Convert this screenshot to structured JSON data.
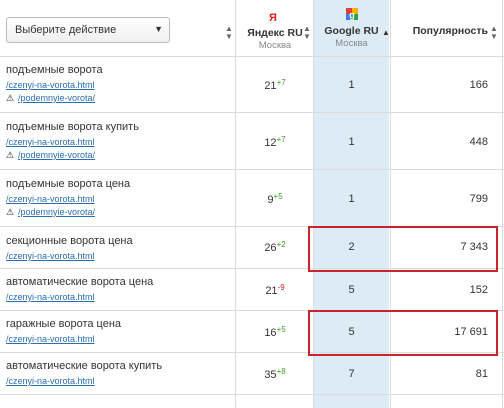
{
  "header": {
    "action_select_value": "Выберите действие",
    "yandex_title": "Яндекс RU",
    "yandex_region": "Москва",
    "google_title": "Google RU",
    "google_region": "Москва",
    "popularity_title": "Популярность"
  },
  "rows": [
    {
      "keyword": "подъемные ворота",
      "url": "/czenyi-na-vorota.html",
      "warning": "/podemnyie-vorota/",
      "yandex": "21",
      "yandex_delta": "+7",
      "google": "1",
      "popularity": "166"
    },
    {
      "keyword": "подъемные ворота купить",
      "url": "/czenyi-na-vorota.html",
      "warning": "/podemnyie-vorota/",
      "yandex": "12",
      "yandex_delta": "+7",
      "google": "1",
      "popularity": "448"
    },
    {
      "keyword": "подъемные ворота цена",
      "url": "/czenyi-na-vorota.html",
      "warning": "/podemnyie-vorota/",
      "yandex": "9",
      "yandex_delta": "+5",
      "google": "1",
      "popularity": "799"
    },
    {
      "keyword": "секционные ворота цена",
      "url": "/czenyi-na-vorota.html",
      "yandex": "26",
      "yandex_delta": "+2",
      "google": "2",
      "popularity": "7 343"
    },
    {
      "keyword": "автоматические ворота цена",
      "url": "/czenyi-na-vorota.html",
      "yandex": "21",
      "yandex_delta": "-9",
      "google": "5",
      "popularity": "152"
    },
    {
      "keyword": "гаражные ворота цена",
      "url": "/czenyi-na-vorota.html",
      "yandex": "16",
      "yandex_delta": "+5",
      "google": "5",
      "popularity": "17 691"
    },
    {
      "keyword": "автоматические ворота купить",
      "url": "/czenyi-na-vorota.html",
      "yandex": "35",
      "yandex_delta": "+8",
      "google": "7",
      "popularity": "81"
    }
  ],
  "colors": {
    "google_column_bg": "#dcebf5",
    "highlight_border": "#c8242c",
    "link": "#2a6db0",
    "delta_up": "#3a9a23",
    "delta_down": "#d21e1e"
  }
}
